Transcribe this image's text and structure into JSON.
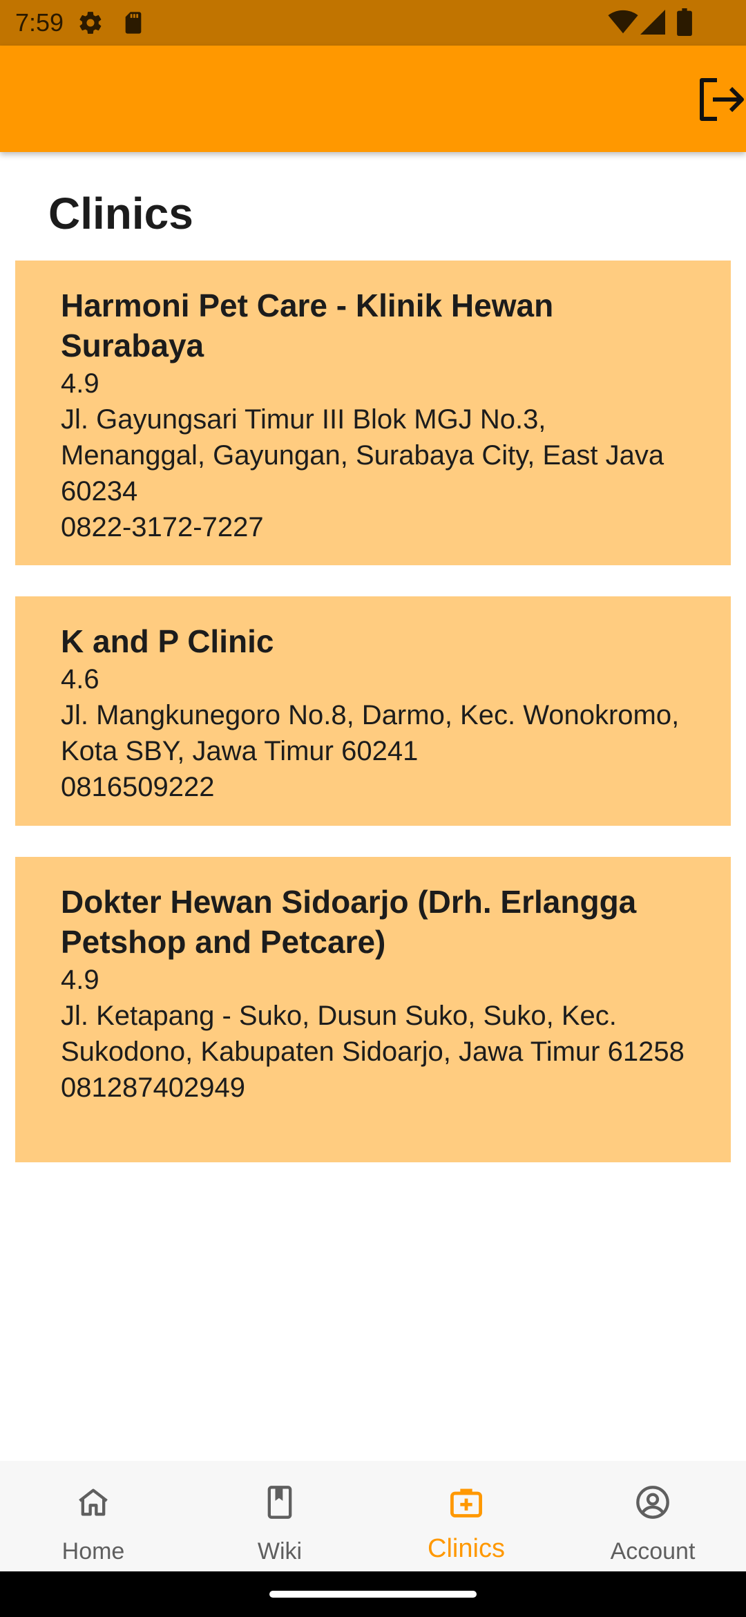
{
  "status_bar": {
    "time": "7:59",
    "icons": [
      "gear-icon",
      "sd-card-icon",
      "wifi-icon",
      "signal-icon",
      "battery-icon"
    ]
  },
  "app_bar": {
    "color": "#ff9800",
    "action_icon": "logout-icon"
  },
  "page": {
    "title": "Clinics"
  },
  "clinics": [
    {
      "name": "Harmoni Pet Care - Klinik Hewan Surabaya",
      "rating": "4.9",
      "address": "Jl. Gayungsari Timur III Blok MGJ No.3, Menanggal, Gayungan, Surabaya City, East Java 60234",
      "phone": "0822-3172-7227"
    },
    {
      "name": "K and P Clinic",
      "rating": "4.6",
      "address": "Jl. Mangkunegoro No.8, Darmo, Kec. Wonokromo, Kota SBY, Jawa Timur 60241",
      "phone": "0816509222"
    },
    {
      "name": "Dokter Hewan Sidoarjo (Drh. Erlangga Petshop and Petcare)",
      "rating": "4.9",
      "address": "Jl. Ketapang - Suko, Dusun Suko, Suko, Kec. Sukodono, Kabupaten Sidoarjo, Jawa Timur 61258",
      "phone": "081287402949"
    }
  ],
  "card_color": "#ffcc80",
  "bottom_nav": {
    "items": [
      {
        "label": "Home",
        "icon": "home-icon"
      },
      {
        "label": "Wiki",
        "icon": "book-icon"
      },
      {
        "label": "Clinics",
        "icon": "medical-bag-icon",
        "active": true
      },
      {
        "label": "Account",
        "icon": "account-circle-icon"
      }
    ],
    "active_color": "#ff9800"
  }
}
